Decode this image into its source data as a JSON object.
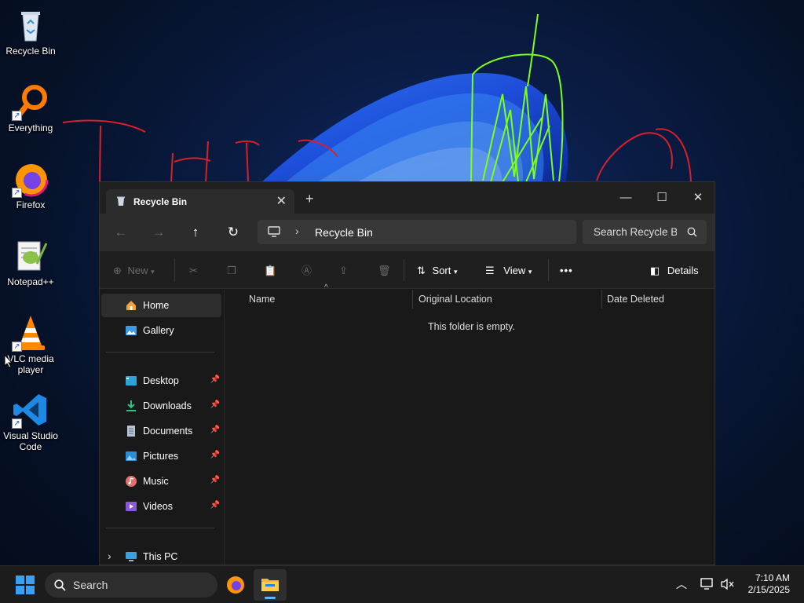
{
  "desktop": {
    "icons": [
      {
        "label": "Recycle Bin"
      },
      {
        "label": "Everything"
      },
      {
        "label": "Firefox"
      },
      {
        "label": "Notepad++"
      },
      {
        "label": "VLC media player"
      },
      {
        "label": "Visual Studio Code"
      }
    ]
  },
  "window": {
    "tab_title": "Recycle Bin",
    "address": {
      "path": "Recycle Bin"
    },
    "search_placeholder": "Search Recycle Bin",
    "toolbar": {
      "new": "New",
      "sort": "Sort",
      "view": "View",
      "details": "Details"
    },
    "sidebar": {
      "items": [
        {
          "label": "Home"
        },
        {
          "label": "Gallery"
        },
        {
          "label": "Desktop"
        },
        {
          "label": "Downloads"
        },
        {
          "label": "Documents"
        },
        {
          "label": "Pictures"
        },
        {
          "label": "Music"
        },
        {
          "label": "Videos"
        },
        {
          "label": "This PC"
        }
      ]
    },
    "columns": [
      "Name",
      "Original Location",
      "Date Deleted"
    ],
    "empty_message": "This folder is empty."
  },
  "taskbar": {
    "search_label": "Search",
    "time": "7:10 AM",
    "date": "2/15/2025"
  },
  "colors": {
    "accent": "#0078d4",
    "window_bg": "#191919",
    "taskbar_bg": "#1c1c1c"
  }
}
